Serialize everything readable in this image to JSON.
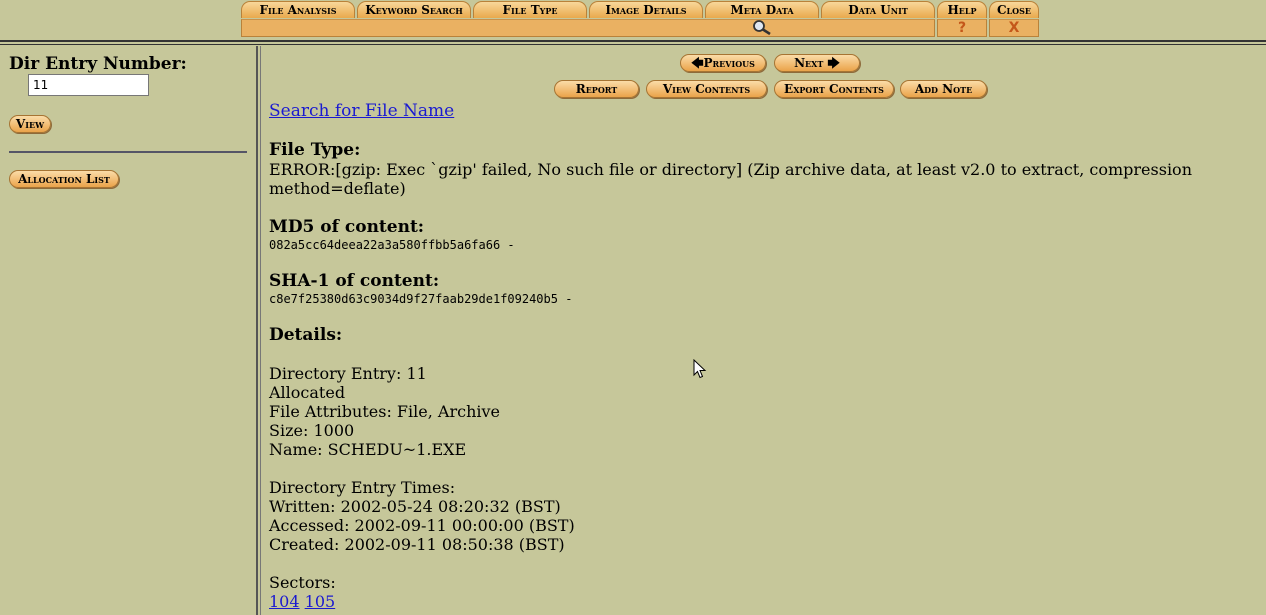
{
  "tabs": [
    {
      "label": "File Analysis"
    },
    {
      "label": "Keyword Search"
    },
    {
      "label": "File Type"
    },
    {
      "label": "Image Details"
    },
    {
      "label": "Meta Data"
    },
    {
      "label": "Data Unit"
    },
    {
      "label": "Help"
    },
    {
      "label": "Close"
    }
  ],
  "tab_icons": {
    "help": "?",
    "close": "X",
    "meta_data": "magnifier-icon"
  },
  "sidebar": {
    "label": "Dir Entry Number:",
    "input_value": "11",
    "view_button": "View",
    "allocation_button": "Allocation List"
  },
  "nav": {
    "previous": "Previous",
    "next": "Next"
  },
  "actions": {
    "report": "Report",
    "view_contents": "View Contents",
    "export_contents": "Export Contents",
    "add_note": "Add Note"
  },
  "main": {
    "search_link": "Search for File Name",
    "file_type_heading": "File Type:",
    "file_type_line1": "ERROR:[gzip: Exec `gzip' failed, No such file or directory] (Zip archive data, at least v2.0 to extract, compression",
    "file_type_line2": "method=deflate)",
    "md5_heading": "MD5 of content:",
    "md5_value": "082a5cc64deea22a3a580ffbb5a6fa66  -",
    "sha1_heading": "SHA-1 of content:",
    "sha1_value": "c8e7f25380d63c9034d9f27faab29de1f09240b5  -",
    "details_heading": "Details:",
    "dir_entry": "Directory Entry: 11",
    "allocated": "Allocated",
    "attributes": "File Attributes: File, Archive",
    "size": "Size: 1000",
    "name": "Name: SCHEDU~1.EXE",
    "times_heading": "Directory Entry Times:",
    "written": "Written: 2002-05-24 08:20:32 (BST)",
    "accessed": "Accessed: 2002-09-11 00:00:00 (BST)",
    "created": "Created: 2002-09-11 08:50:38 (BST)",
    "sectors_heading": "Sectors:",
    "sectors": [
      "104",
      "105"
    ]
  },
  "colors": {
    "background": "#c6c79a",
    "tab": "#eaa34a",
    "link": "#1a1ad0"
  }
}
